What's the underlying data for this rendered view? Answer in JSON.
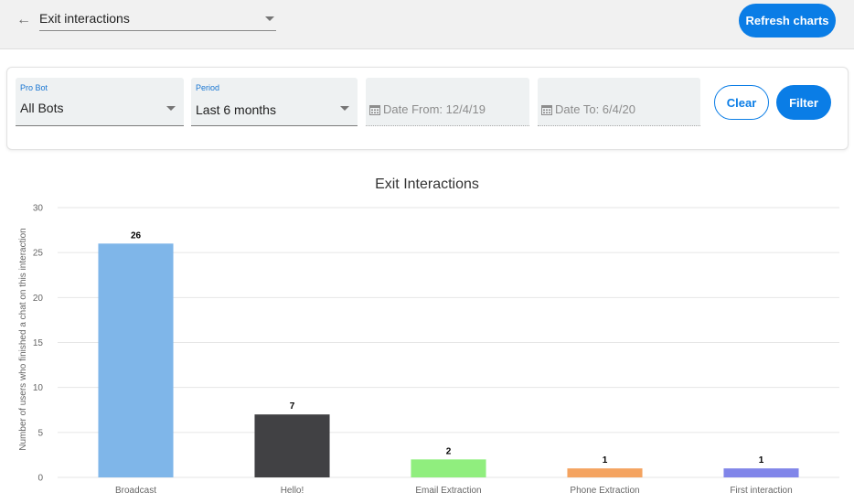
{
  "topbar": {
    "back_icon": "arrow-left-icon",
    "report_select_value": "Exit interactions",
    "refresh_label": "Refresh charts"
  },
  "filters": {
    "bot": {
      "label": "Pro Bot",
      "value": "All Bots"
    },
    "period": {
      "label": "Period",
      "value": "Last 6 months"
    },
    "date_from": "Date From: 12/4/19",
    "date_to": "Date To: 6/4/20",
    "clear_label": "Clear",
    "filter_label": "Filter"
  },
  "colors": {
    "accent": "#0a7de6"
  },
  "chart_data": {
    "type": "bar",
    "title": "Exit Interactions",
    "ylabel": "Number of users who finished a chat on this interaction",
    "xlabel": "",
    "ylim": [
      0,
      30
    ],
    "yticks": [
      0,
      5,
      10,
      15,
      20,
      25,
      30
    ],
    "grid": true,
    "categories": [
      "Broadcast",
      "Hello!",
      "Email Extraction",
      "Phone Extraction",
      "First interaction"
    ],
    "values": [
      26,
      7,
      2,
      1,
      1
    ],
    "data_labels": [
      "26",
      "7",
      "2",
      "1",
      "1"
    ],
    "bar_colors": [
      "#7fb6e9",
      "#414144",
      "#90ee7e",
      "#f4a360",
      "#8085e9"
    ]
  }
}
